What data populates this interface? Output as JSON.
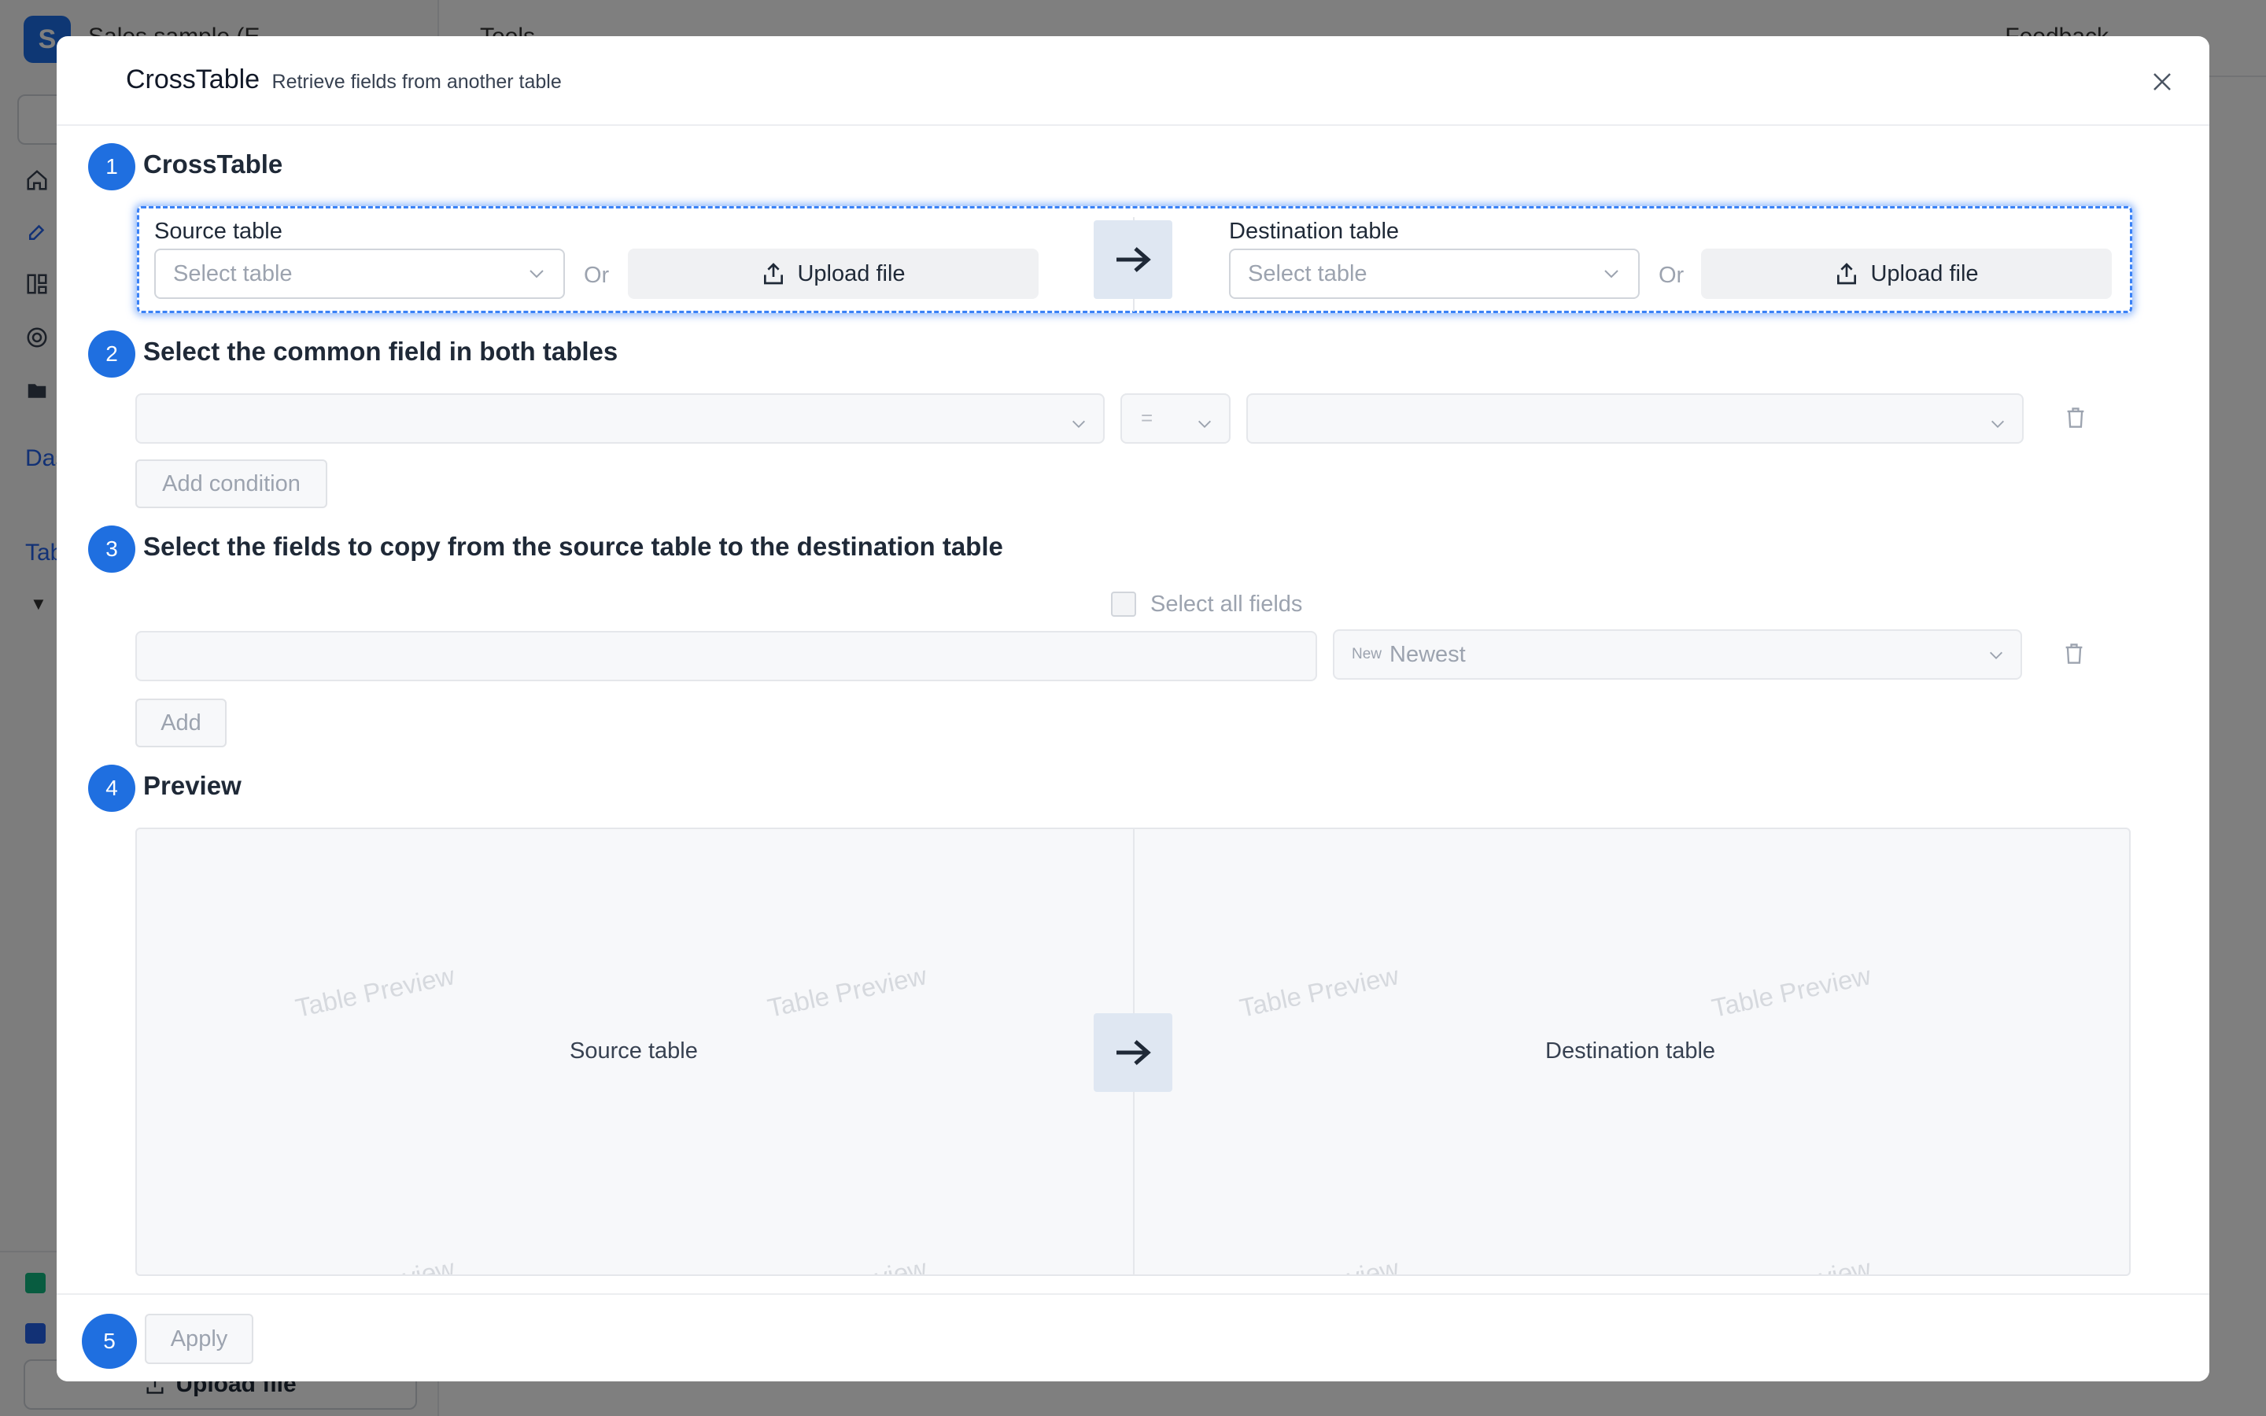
{
  "background": {
    "workspace_initial": "S",
    "workspace_name": "Sales sample (E",
    "topbar_tools": "Tools",
    "topbar_feedback": "Feedback",
    "sidebar_section_dashboards": "Das",
    "sidebar_section_tables": "Tab",
    "upload_label": "Upload file"
  },
  "modal": {
    "title": "CrossTable",
    "subtitle": "Retrieve fields from another table",
    "steps": [
      {
        "number": "1",
        "title": "CrossTable"
      },
      {
        "number": "2",
        "title": "Select the common field in both tables"
      },
      {
        "number": "3",
        "title": "Select the fields to copy from the source table to the destination table"
      },
      {
        "number": "4",
        "title": "Preview"
      },
      {
        "number": "5"
      }
    ],
    "source": {
      "label": "Source table",
      "select_placeholder": "Select table",
      "or": "Or",
      "upload_label": "Upload file"
    },
    "destination": {
      "label": "Destination table",
      "select_placeholder": "Select table",
      "or": "Or",
      "upload_label": "Upload file"
    },
    "condition": {
      "operator": "=",
      "add_condition_label": "Add condition"
    },
    "fields": {
      "select_all_label": "Select all fields",
      "mode_tag": "New",
      "mode_value": "Newest",
      "add_label": "Add"
    },
    "preview": {
      "watermark": "Table Preview",
      "source_label": "Source table",
      "destination_label": "Destination table"
    },
    "apply_label": "Apply"
  },
  "colors": {
    "accent": "#1f6fe0",
    "focus_border": "#3b82f6",
    "arrow_bg": "#dfe7f2"
  }
}
